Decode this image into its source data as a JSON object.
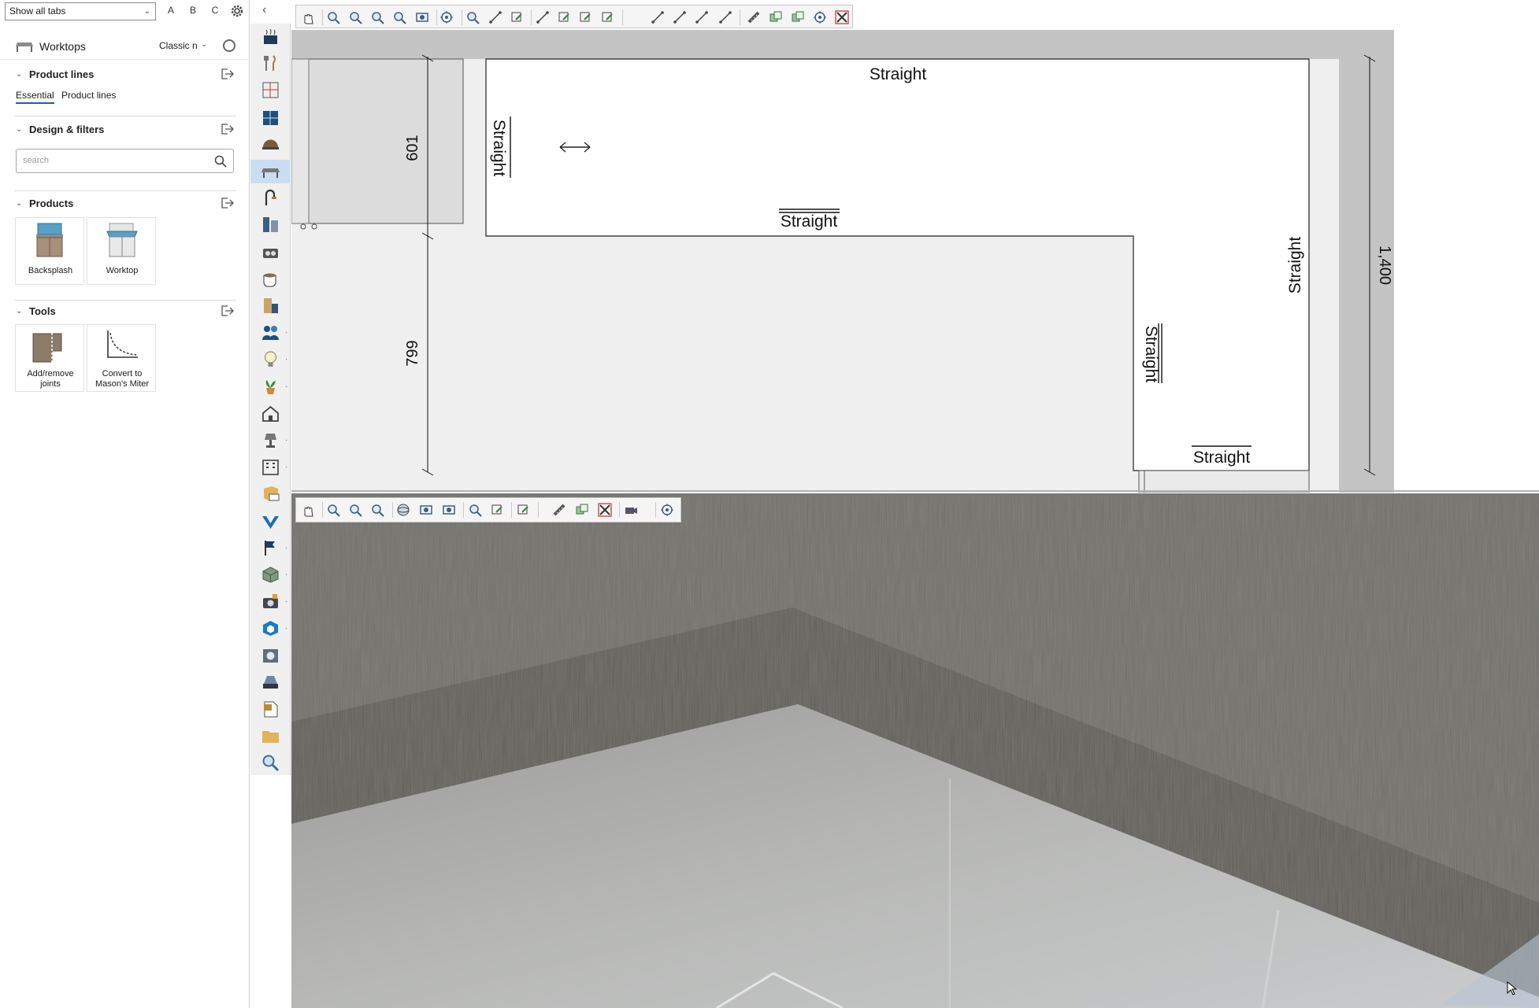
{
  "top_bar": {
    "tab_filter": "Show all tabs",
    "letters": [
      "A",
      "B",
      "C"
    ]
  },
  "panel": {
    "title": "Worktops",
    "mode": "Classic n"
  },
  "sections": {
    "product_lines": {
      "title": "Product lines",
      "tabs": [
        "Essential",
        "Product lines"
      ],
      "active_tab": "Essential"
    },
    "design_filters": {
      "title": "Design & filters",
      "search_placeholder": "search"
    },
    "products": {
      "title": "Products",
      "items": [
        "Backsplash",
        "Worktop"
      ]
    },
    "tools": {
      "title": "Tools",
      "items": [
        "Add/remove joints",
        "Convert to Mason's Miter"
      ],
      "item_lines": [
        [
          "Add/remove",
          "joints"
        ],
        [
          "Convert to",
          "Mason's Miter"
        ]
      ]
    }
  },
  "tool_strip": {
    "icons": [
      "stove-icon",
      "utensils-icon",
      "wall-panel-icon",
      "cabinet-grid-icon",
      "sink-bowl-icon",
      "worktop-icon",
      "faucet-icon",
      "tall-cabinet-icon",
      "appliance-icon",
      "coffee-cup-icon",
      "door-icon",
      "people-icon",
      "light-bulb-icon",
      "plant-icon",
      "house-icon",
      "lamp-icon",
      "building-icon",
      "pdf-box-icon",
      "v-logo-icon",
      "flag-icon",
      "cube-icon",
      "camera-icon",
      "sketchup-icon",
      "render-icon",
      "print-icon",
      "pdf-doc-icon",
      "folder-icon",
      "magnifier-icon"
    ],
    "selected": "worktop-icon"
  },
  "plan": {
    "labels": [
      "Straight",
      "Straight",
      "Straight",
      "Straight",
      "Straight",
      "Straight"
    ],
    "dimensions": [
      "601",
      "799",
      "1,400"
    ]
  },
  "colors": {
    "selection": "#c9def2",
    "panel_border": "#cfcfcf",
    "worktop_fill": "#ffffff",
    "wall_fill": "#c4c4c4"
  }
}
